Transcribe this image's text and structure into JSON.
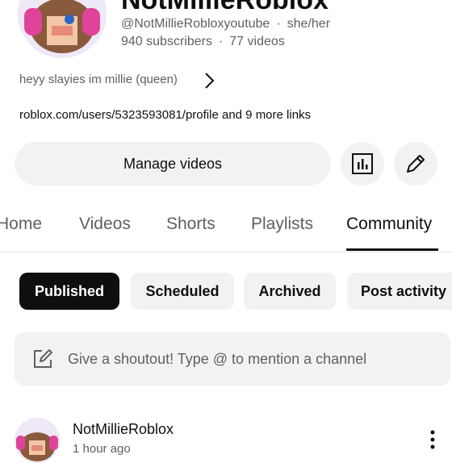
{
  "channel": {
    "title": "NotMillieRoblox",
    "handle": "@NotMillieRobloxyoutube",
    "pronouns": "she/her",
    "subscribers": "940 subscribers",
    "videos": "77 videos",
    "bio": "heyy slayies im millie (queen)",
    "links": "roblox.com/users/5323593081/profile and 9 more links"
  },
  "actions": {
    "manage_label": "Manage videos",
    "analytics_icon": "analytics-icon",
    "edit_icon": "pencil-icon"
  },
  "tabs": [
    {
      "label": "Home"
    },
    {
      "label": "Videos"
    },
    {
      "label": "Shorts"
    },
    {
      "label": "Playlists"
    },
    {
      "label": "Community",
      "active": true
    }
  ],
  "chips": [
    {
      "label": "Published",
      "active": true
    },
    {
      "label": "Scheduled"
    },
    {
      "label": "Archived"
    },
    {
      "label": "Post activity"
    }
  ],
  "shoutout": {
    "placeholder": "Give a shoutout! Type @ to mention a channel"
  },
  "post": {
    "author": "NotMillieRoblox",
    "time": "1 hour ago"
  },
  "colors": {
    "text_primary": "#0f0f0f",
    "text_secondary": "#606060",
    "chip_bg": "#f2f2f2",
    "chip_active_bg": "#0f0f0f",
    "avatar_accent": "#e0439a"
  }
}
